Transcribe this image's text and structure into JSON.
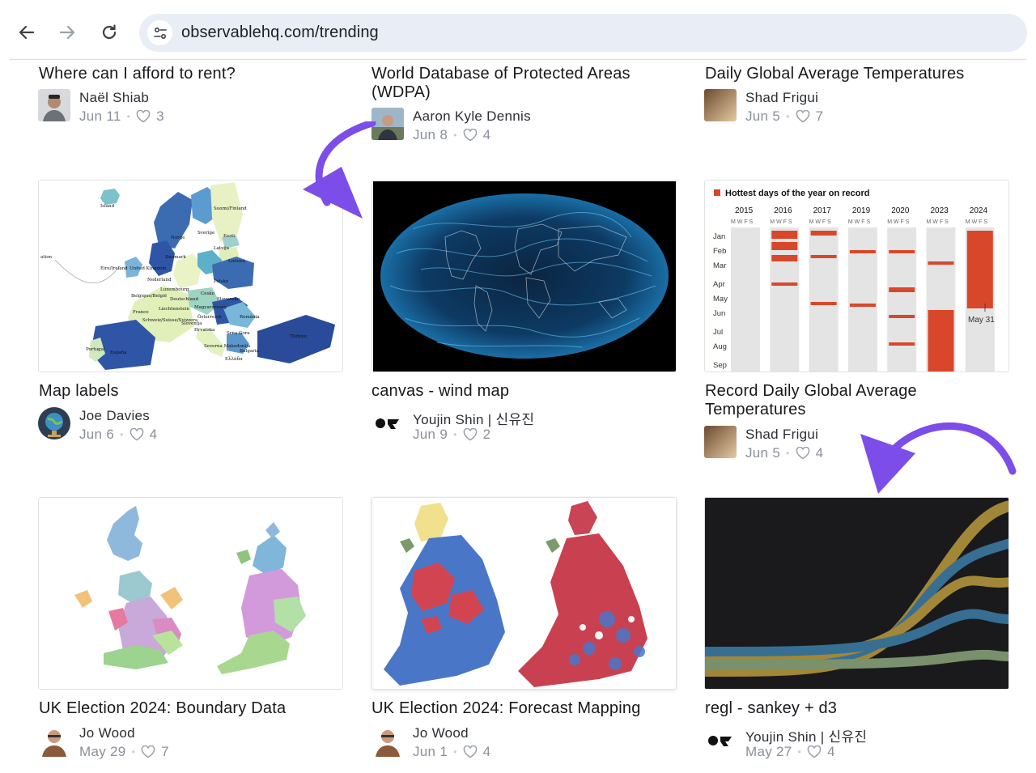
{
  "browser": {
    "url": "observablehq.com/trending"
  },
  "cards": [
    {
      "title": "Where can I afford to rent?",
      "author": "Naël Shiab",
      "date": "Jun 11",
      "likes": "3"
    },
    {
      "title": "World Database of Protected Areas (WDPA)",
      "author": "Aaron Kyle Dennis",
      "date": "Jun 8",
      "likes": "4"
    },
    {
      "title": "Daily Global Average Temperatures",
      "author": "Shad Frigui",
      "date": "Jun 5",
      "likes": "7"
    },
    {
      "title": "Map labels",
      "author": "Joe Davies",
      "date": "Jun 6",
      "likes": "4"
    },
    {
      "title": "canvas - wind map",
      "author": "Youjin Shin | 신유진",
      "date": "Jun 9",
      "likes": "2"
    },
    {
      "title": "Record Daily Global Average Temperatures",
      "author": "Shad Frigui",
      "date": "Jun 5",
      "likes": "4"
    },
    {
      "title": "UK Election 2024: Boundary Data",
      "author": "Jo Wood",
      "date": "May 29",
      "likes": "7"
    },
    {
      "title": "UK Election 2024: Forecast Mapping",
      "author": "Jo Wood",
      "date": "Jun 1",
      "likes": "4"
    },
    {
      "title": "regl - sankey + d3",
      "author": "Youjin Shin | 신유진",
      "date": "May 27",
      "likes": "4"
    }
  ],
  "thumbs": {
    "map_labels": {
      "labels": [
        "Island",
        "Suomi/Finland",
        "Sverige",
        "Norge",
        "Eesti",
        "Latvija",
        "Danmark",
        "Lietuva",
        "Éire/Ireland",
        "United Kingdom",
        "Nederland",
        "Polska",
        "Belgique/België",
        "Luxembourg",
        "Deutschland",
        "Cesko",
        "Slovensko",
        "France",
        "Liechtenstein",
        "Magyarország",
        "Schweiz/Suisse/Svizzera",
        "Österreich",
        "România",
        "Slovenija",
        "Hrvatska",
        "Srna Gora",
        "Portugal",
        "España",
        "Severna Makedonija",
        "Türkiye",
        "Bulgaria",
        "Ελλάδα",
        "ation"
      ]
    },
    "heatmap": {
      "title": "Hottest days of the year on record",
      "years": [
        "2015",
        "2016",
        "2017",
        "2019",
        "2020",
        "2023",
        "2024"
      ],
      "weekdays": "M W F S",
      "months": [
        "Jan",
        "Feb",
        "Mar",
        "Apr",
        "May",
        "Jun",
        "Jul",
        "Aug",
        "Sep"
      ],
      "annotation": "May 31",
      "accent": "#d9472b"
    }
  },
  "colors": {
    "arrow": "#7c4de8",
    "heart": "#9aa0a8"
  },
  "icons": {
    "back": "arrow-left-icon",
    "forward": "arrow-right-icon",
    "reload": "reload-icon",
    "site_info": "tune-icon",
    "like": "heart-icon"
  }
}
